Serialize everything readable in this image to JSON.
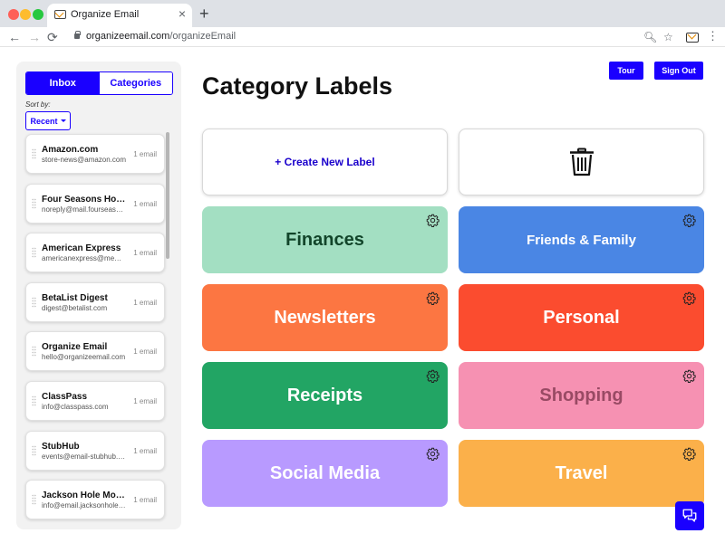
{
  "browser": {
    "tab_title": "Organize Email",
    "tab_close": "×",
    "new_tab": "+",
    "url_host": "organizeemail.com",
    "url_path": "/organizeEmail",
    "back_glyph": "←",
    "forward_glyph": "→",
    "reload_glyph": "⟳",
    "zoom_glyph": "🔍︎",
    "star_glyph": "☆",
    "menu_glyph": "⋮"
  },
  "sidebar": {
    "tabs": [
      {
        "label": "Inbox",
        "active": true
      },
      {
        "label": "Categories",
        "active": false
      }
    ],
    "sort_label": "Sort by:",
    "sort_value": "Recent",
    "emails": [
      {
        "sender": "Amazon.com",
        "address": "store-news@amazon.com",
        "count": "1 email"
      },
      {
        "sender": "Four Seasons Hotels",
        "address": "noreply@mail.fourseasons.com",
        "count": "1 email"
      },
      {
        "sender": "American Express",
        "address": "americanexpress@member.americanexpress.com",
        "count": "1 email"
      },
      {
        "sender": "BetaList Digest",
        "address": "digest@betalist.com",
        "count": "1 email"
      },
      {
        "sender": "Organize Email",
        "address": "hello@organizeemail.com",
        "count": "1 email"
      },
      {
        "sender": "ClassPass",
        "address": "info@classpass.com",
        "count": "1 email"
      },
      {
        "sender": "StubHub",
        "address": "events@email-stubhub.com",
        "count": "1 email"
      },
      {
        "sender": "Jackson Hole Mountain Resort",
        "address": "info@email.jacksonhole.com",
        "count": "1 email"
      }
    ]
  },
  "header": {
    "title": "Category Labels",
    "tour_label": "Tour",
    "signout_label": "Sign Out"
  },
  "actions": {
    "create_label": "+ Create New Label",
    "delete_icon": "trash-icon"
  },
  "categories": [
    {
      "name": "Finances",
      "color": "#a3dfc2",
      "text_color": "#12452a"
    },
    {
      "name": "Friends & Family",
      "color": "#4a86e4",
      "text_color": "#ffffff"
    },
    {
      "name": "Newsletters",
      "color": "#fc7642",
      "text_color": "#ffffff"
    },
    {
      "name": "Personal",
      "color": "#fb4c2f",
      "text_color": "#ffffff"
    },
    {
      "name": "Receipts",
      "color": "#22a564",
      "text_color": "#ffffff"
    },
    {
      "name": "Shopping",
      "color": "#f691b2",
      "text_color": "#994a64"
    },
    {
      "name": "Social Media",
      "color": "#b89aff",
      "text_color": "#ffffff"
    },
    {
      "name": "Travel",
      "color": "#fbb04a",
      "text_color": "#ffffff"
    }
  ],
  "colors": {
    "accent": "#1a00ff"
  }
}
